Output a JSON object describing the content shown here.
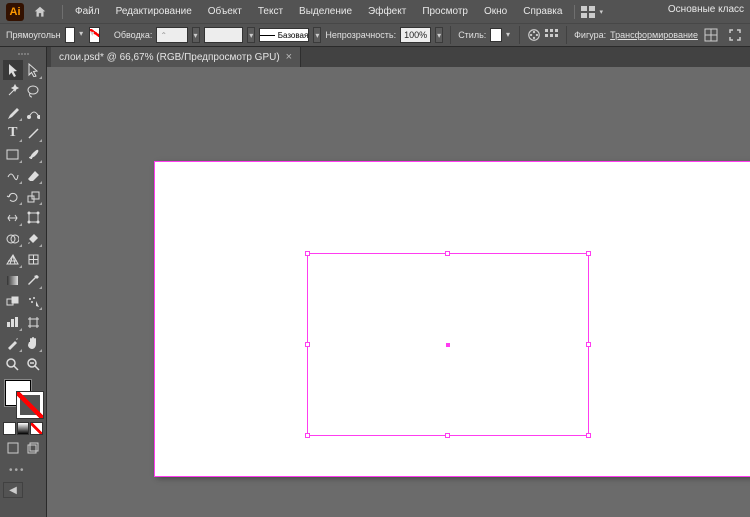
{
  "app": {
    "icon_text": "Ai"
  },
  "menu": [
    "Файл",
    "Редактирование",
    "Объект",
    "Текст",
    "Выделение",
    "Эффект",
    "Просмотр",
    "Окно",
    "Справка"
  ],
  "workspace": {
    "label": "Основные класс"
  },
  "control": {
    "shape_label": "Прямоугольн",
    "stroke_label": "Обводка:",
    "stroke_value": "",
    "stroke_style": "Базовая",
    "opacity_label": "Непрозрачность:",
    "opacity_value": "100%",
    "style_label": "Стиль:",
    "shape_word": "Фигура:",
    "transform_word": "Трансформирование"
  },
  "document": {
    "tab_title": "слои.psd* @ 66,67% (RGB/Предпросмотр GPU)"
  },
  "toolbox": {
    "more": "•••"
  }
}
